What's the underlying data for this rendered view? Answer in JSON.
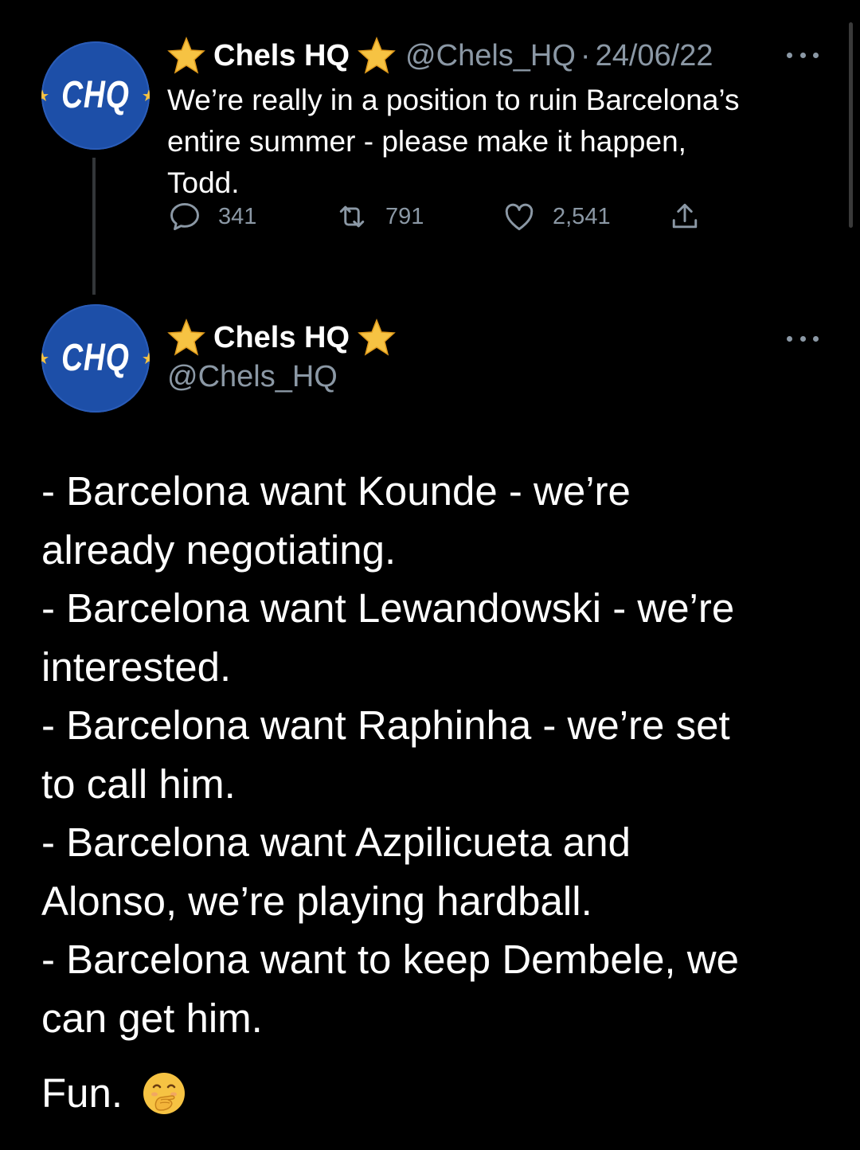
{
  "reply_tweet": {
    "avatar_text": "CHQ",
    "display_name": "Chels HQ",
    "handle": "@Chels_HQ",
    "separator": "·",
    "date": "24/06/22",
    "text": "We’re really in a position to ruin Barcelona’s\nentire summer - please make it happen,\nTodd.",
    "counts": {
      "replies": "341",
      "retweets": "791",
      "likes": "2,541"
    }
  },
  "main_tweet": {
    "avatar_text": "CHQ",
    "display_name": "Chels HQ",
    "handle": "@Chels_HQ",
    "lines": [
      "- Barcelona want Kounde - we’re",
      "already negotiating.",
      "- Barcelona want Lewandowski - we’re",
      "interested.",
      "- Barcelona want Raphinha - we’re set",
      "to call him.",
      "- Barcelona want Azpilicueta and",
      "Alonso, we’re playing hardball.",
      "- Barcelona want to keep Dembele, we",
      "can get him."
    ],
    "closing": "Fun.",
    "closing_emoji": "face-with-hand-over-mouth-icon"
  },
  "colors": {
    "background": "#000000",
    "text": "#ffffff",
    "secondary": "#8b98a5",
    "avatar_blue": "#1d4fa8",
    "star_gold": "#f6c343"
  }
}
